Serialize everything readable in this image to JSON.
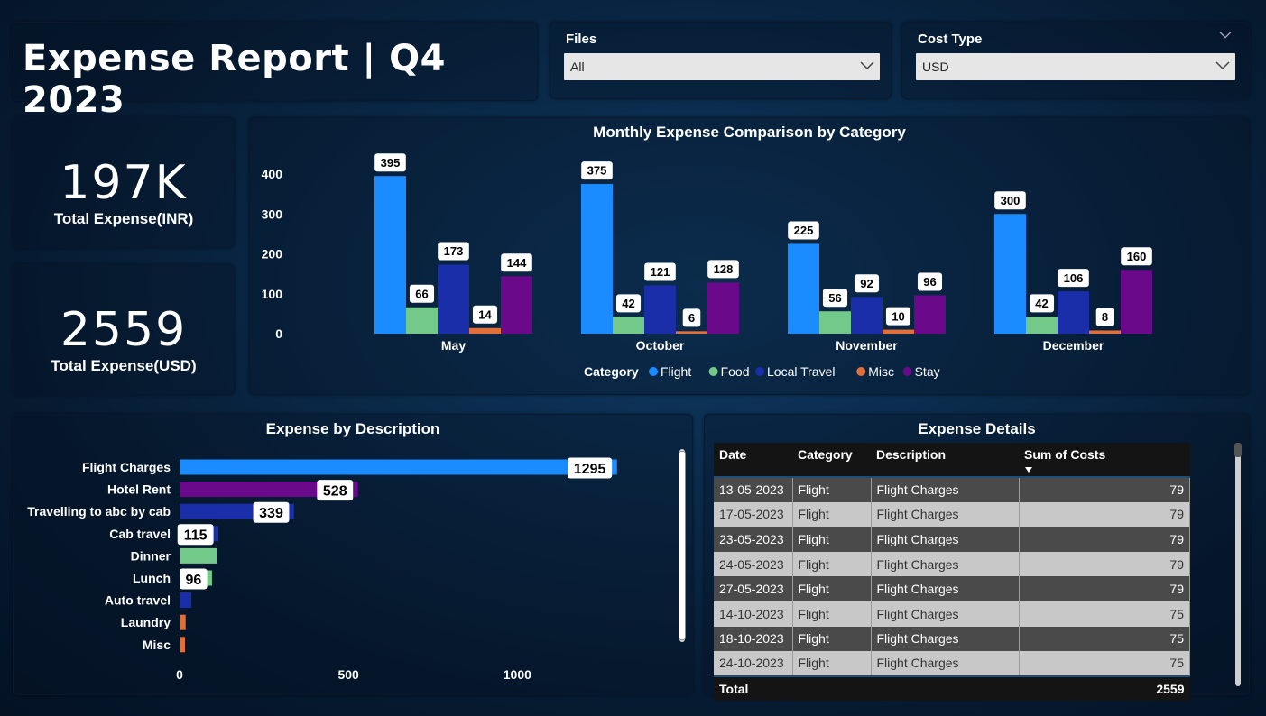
{
  "header": {
    "title": "Expense Report | Q4 2023"
  },
  "filters": {
    "files": {
      "label": "Files",
      "value": "All"
    },
    "cost_type": {
      "label": "Cost Type",
      "value": "USD"
    }
  },
  "kpis": {
    "inr": {
      "value": "197K",
      "label": "Total Expense(INR)"
    },
    "usd": {
      "value": "2559",
      "label": "Total Expense(USD)"
    }
  },
  "colors": {
    "Flight": "#1a8cff",
    "Food": "#72c98a",
    "Local Travel": "#1a2eaa",
    "Misc": "#e0703a",
    "Stay": "#6a0a8a"
  },
  "chart_data": [
    {
      "type": "bar",
      "title": "Monthly Expense Comparison by Category",
      "categories": [
        "May",
        "October",
        "November",
        "December"
      ],
      "series": [
        {
          "name": "Flight",
          "values": [
            395,
            375,
            225,
            300
          ]
        },
        {
          "name": "Food",
          "values": [
            66,
            42,
            56,
            42
          ]
        },
        {
          "name": "Local Travel",
          "values": [
            173,
            121,
            92,
            106
          ]
        },
        {
          "name": "Misc",
          "values": [
            14,
            6,
            10,
            8
          ]
        },
        {
          "name": "Stay",
          "values": [
            144,
            128,
            96,
            160
          ]
        }
      ],
      "yticks": [
        "400",
        "300",
        "200",
        "100",
        "0"
      ],
      "ylim": [
        0,
        400
      ],
      "legend_title": "Category",
      "legend_position": "bottom-center"
    },
    {
      "type": "bar",
      "orientation": "horizontal",
      "title": "Expense by Description",
      "categories": [
        "Flight Charges",
        "Hotel Rent",
        "Travelling to abc by cab",
        "Cab travel",
        "Dinner",
        "Lunch",
        "Auto travel",
        "Laundry",
        "Misc"
      ],
      "values": [
        1295,
        528,
        339,
        115,
        110,
        96,
        35,
        18,
        16
      ],
      "data_labels": [
        "1295",
        "528",
        "339",
        "115",
        "",
        "96",
        "",
        "",
        ""
      ],
      "bar_categories": [
        "Flight",
        "Stay",
        "Local Travel",
        "Local Travel",
        "Food",
        "Food",
        "Local Travel",
        "Misc",
        "Misc"
      ],
      "xticks": [
        "0",
        "500",
        "1000"
      ],
      "xlim": [
        0,
        1325
      ]
    }
  ],
  "details": {
    "title": "Expense Details",
    "columns": [
      "Date",
      "Category",
      "Description",
      "Sum of Costs"
    ],
    "rows": [
      [
        "13-05-2023",
        "Flight",
        "Flight Charges",
        "79"
      ],
      [
        "17-05-2023",
        "Flight",
        "Flight Charges",
        "79"
      ],
      [
        "23-05-2023",
        "Flight",
        "Flight Charges",
        "79"
      ],
      [
        "24-05-2023",
        "Flight",
        "Flight Charges",
        "79"
      ],
      [
        "27-05-2023",
        "Flight",
        "Flight Charges",
        "79"
      ],
      [
        "14-10-2023",
        "Flight",
        "Flight Charges",
        "75"
      ],
      [
        "18-10-2023",
        "Flight",
        "Flight Charges",
        "75"
      ],
      [
        "24-10-2023",
        "Flight",
        "Flight Charges",
        "75"
      ]
    ],
    "total_label": "Total",
    "total_value": "2559"
  }
}
